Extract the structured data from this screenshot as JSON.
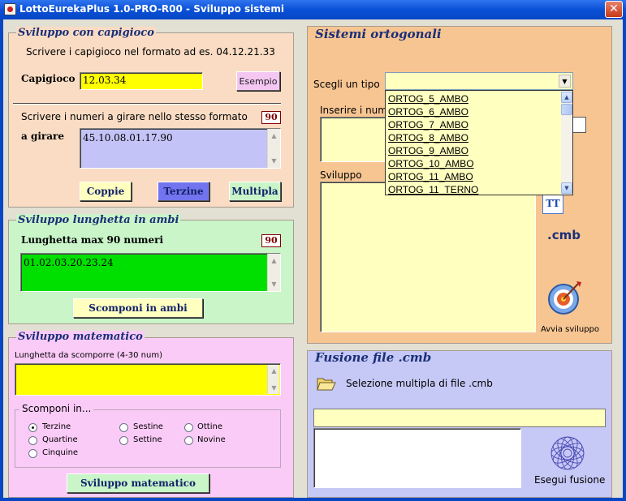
{
  "window": {
    "title": "LottoEurekaPlus 1.0-PRO-R00 - Sviluppo sistemi",
    "close": "✕"
  },
  "capigioco": {
    "title": "Sviluppo con capigioco",
    "instruction": "Scrivere i capigioco nel formato ad es. 04.12.21.33",
    "field_label": "Capigioco",
    "field_value": "12.03.34",
    "example_button": "Esempio",
    "numbers_instruction": "Scrivere i numeri a girare nello stesso formato",
    "badge": "90",
    "girare_label": "a girare",
    "girare_value": "45.10.08.01.17.90",
    "buttons": {
      "coppie": "Coppie",
      "terzine": "Terzine",
      "multipla": "Multipla"
    }
  },
  "lunghetta": {
    "title": "Sviluppo lunghetta in ambi",
    "label": "Lunghetta max 90 numeri",
    "badge": "90",
    "value": "01.02.03.20.23.24",
    "button": "Scomponi in ambi"
  },
  "matematico": {
    "title": "Sviluppo matematico",
    "label": "Lunghetta da scomporre (4-30 num)",
    "value": "",
    "group_title": "Scomponi in...",
    "options": [
      "Terzine",
      "Quartine",
      "Cinquine",
      "Sestine",
      "Settine",
      "Ottine",
      "Novine"
    ],
    "selected": "Terzine",
    "button": "Sviluppo matematico"
  },
  "ortogonali": {
    "title": "Sistemi ortogonali",
    "type_label": "Scegli un tipo",
    "insert_label_visible": "Inserire i nume",
    "sviluppo_label": "Sviluppo",
    "dropdown_items": [
      "ORTOG_5_AMBO",
      "ORTOG_6_AMBO",
      "ORTOG_7_AMBO",
      "ORTOG_8_AMBO",
      "ORTOG_9_AMBO",
      "ORTOG_10_AMBO",
      "ORTOG_11_AMBO",
      "ORTOG_11_TERNO"
    ],
    "cmb_label": ".cmb",
    "run_label": "Avvia sviluppo",
    "font_icon_text": "TT"
  },
  "fusione": {
    "title": "Fusione file .cmb",
    "select_label": "Selezione multipla di file .cmb",
    "run_label": "Esegui fusione"
  },
  "colors": {
    "titlebar": "#0a50d6",
    "capigioco_bg": "#f9dcc3",
    "lunghetta_bg": "#c9f5c8",
    "matematico_bg": "#fbcbf8",
    "ortogonali_bg": "#f7c592",
    "fusione_bg": "#c6c8f6"
  }
}
